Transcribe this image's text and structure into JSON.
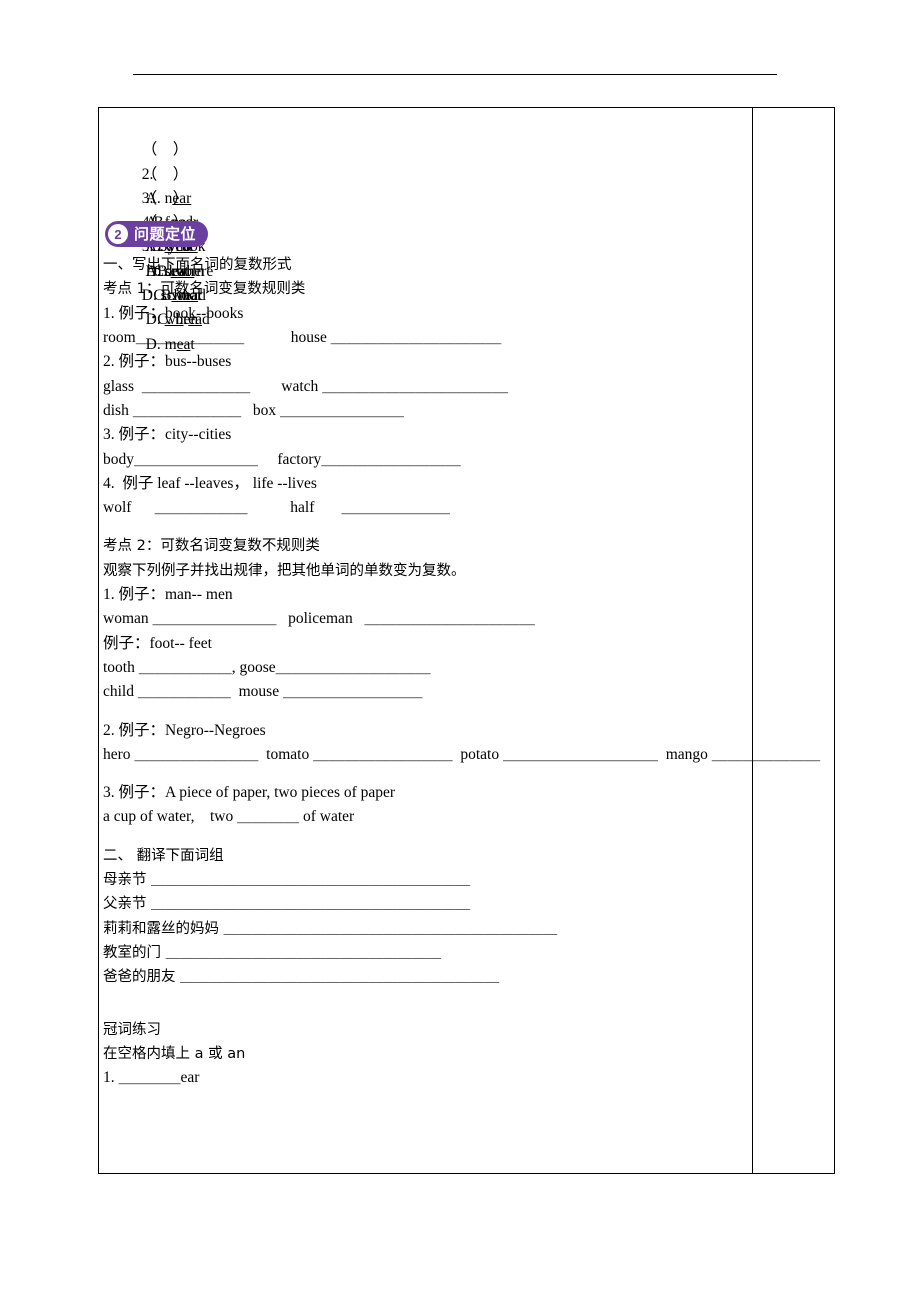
{
  "document": {
    "choice_questions": [
      {
        "marker": "（    ）",
        "num": "2.",
        "options": [
          {
            "label": "A.",
            "word": "near",
            "underline": "ear",
            "pre": "n"
          },
          {
            "label": "B.",
            "word": "pear",
            "underline": "ear",
            "pre": "p"
          },
          {
            "label": "C.",
            "word": "year",
            "underline": "ear",
            "pre": "y"
          },
          {
            "label": "D.",
            "word": "dear",
            "underline": "ear",
            "pre": "d"
          }
        ]
      },
      {
        "marker": "（    ）",
        "num": "3.",
        "options": [
          {
            "label": "A.",
            "word": "food",
            "underline": "oo",
            "pre": "f",
            "post": "d"
          },
          {
            "label": "B.",
            "word": "cook",
            "underline": "oo",
            "pre": "c",
            "post": "k"
          },
          {
            "label": "C.",
            "word": "room",
            "underline": "oo",
            "pre": "r",
            "post": "m"
          },
          {
            "label": "D.",
            "word": "school",
            "underline": "oo",
            "pre": "sch",
            "post": "l"
          }
        ]
      },
      {
        "marker": "（    ）",
        "num": "4.",
        "options": [
          {
            "label": "A.",
            "word": "who",
            "underline": "wh",
            "post": "o"
          },
          {
            "label": "B.",
            "word": "where",
            "underline": "wh",
            "post": "ere"
          },
          {
            "label": "C.",
            "word": "what",
            "underline": "wh",
            "post": "at"
          },
          {
            "label": "D.",
            "word": "when",
            "underline": "wh",
            "post": "en"
          }
        ]
      },
      {
        "marker": "（    ）",
        "num": "5.",
        "options": [
          {
            "label": "A.",
            "word": "seat",
            "underline": "ea",
            "pre": "s",
            "post": "t"
          },
          {
            "label": "B.",
            "word": "read",
            "underline": "ea",
            "pre": "r",
            "post": "d"
          },
          {
            "label": "C.",
            "word": "bread",
            "underline": "ea",
            "pre": "br",
            "post": "d"
          },
          {
            "label": "D.",
            "word": "meat",
            "underline": "ea",
            "pre": "m",
            "post": "t"
          }
        ]
      }
    ],
    "section_badge": {
      "number": "2",
      "label": "问题定位"
    },
    "part_one_title": "一、写出下面名词的复数形式",
    "kaodian1": "考点 1：可数名词变复数规则类",
    "rule1_example": "1. 例子：book--books",
    "rule1_items": "room＿＿＿＿＿＿＿            house ＿＿＿＿＿＿＿＿＿＿＿",
    "rule2_example": "2. 例子：bus--buses",
    "rule2_items_a": "glass  ＿＿＿＿＿＿＿        watch ＿＿＿＿＿＿＿＿＿＿＿＿",
    "rule2_items_b": "dish ＿＿＿＿＿＿＿   box ＿＿＿＿＿＿＿＿",
    "rule3_example": "3. 例子：city--cities",
    "rule3_items": "body＿＿＿＿＿＿＿＿     factory＿＿＿＿＿＿＿＿＿",
    "rule4_example": "4.  例子 leaf --leaves， life --lives",
    "rule4_items": "wolf      ＿＿＿＿＿＿           half       ＿＿＿＿＿＿＿",
    "kaodian2": "考点 2：可数名词变复数不规则类",
    "kaodian2_instruction": "观察下列例子并找出规律，把其他单词的单数变为复数。",
    "irr1_example": "1. 例子：man-- men",
    "irr1_items": "woman ＿＿＿＿＿＿＿＿   policeman   ＿＿＿＿＿＿＿＿＿＿＿",
    "irr2_example": "例子：foot-- feet",
    "irr2_items_a": "tooth ＿＿＿＿＿＿, goose＿＿＿＿＿＿＿＿＿＿",
    "irr2_items_b": "child ＿＿＿＿＿＿  mouse ＿＿＿＿＿＿＿＿＿",
    "irr3_example": "2. 例子：Negro--Negroes",
    "irr3_items": "hero ＿＿＿＿＿＿＿＿  tomato ＿＿＿＿＿＿＿＿＿  potato ＿＿＿＿＿＿＿＿＿＿  mango ＿＿＿＿＿＿＿",
    "irr4_example": "3. 例子：A piece of paper, two pieces of paper",
    "irr4_items": "a cup of water,    two ＿＿＿＿ of water",
    "part_two_title": "二、 翻译下面词组",
    "translate_items": [
      "母亲节 ＿＿＿＿＿＿＿＿＿＿＿＿＿＿＿＿＿＿＿＿＿＿",
      "父亲节 ＿＿＿＿＿＿＿＿＿＿＿＿＿＿＿＿＿＿＿＿＿＿",
      "莉莉和露丝的妈妈 ＿＿＿＿＿＿＿＿＿＿＿＿＿＿＿＿＿＿＿＿＿＿＿",
      "教室的门 ＿＿＿＿＿＿＿＿＿＿＿＿＿＿＿＿＿＿＿",
      "爸爸的朋友 ＿＿＿＿＿＿＿＿＿＿＿＿＿＿＿＿＿＿＿＿＿＿"
    ],
    "article_title": "冠词练习",
    "article_instruction": "在空格内填上 a 或 an",
    "article_item_1": "1. ＿＿＿＿ear"
  }
}
